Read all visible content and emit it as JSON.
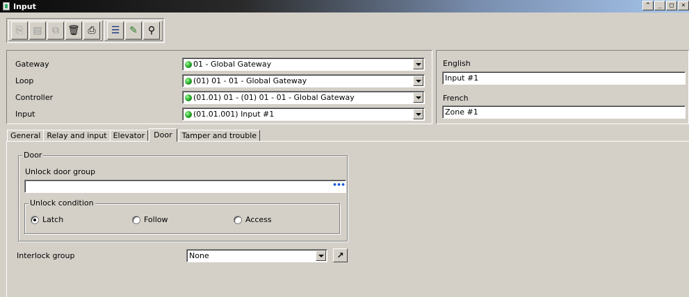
{
  "window": {
    "title": "Input",
    "controls": [
      "^",
      "_",
      "□",
      "×"
    ]
  },
  "toolbar": {
    "buttons": [
      {
        "icon": "new-doc-icon",
        "glyph": "⎘",
        "enabled": false
      },
      {
        "icon": "save-icon",
        "glyph": "▤",
        "enabled": false
      },
      {
        "icon": "copy-icon",
        "glyph": "⧉",
        "enabled": false
      },
      {
        "icon": "trash-icon",
        "glyph": "🗑",
        "enabled": true
      },
      {
        "icon": "print-icon",
        "glyph": "⎙",
        "enabled": true
      },
      {
        "icon": "list-icon",
        "glyph": "☰",
        "enabled": true
      },
      {
        "icon": "link-icon",
        "glyph": "✎",
        "enabled": true
      },
      {
        "icon": "binoculars-icon",
        "glyph": "⚲",
        "enabled": true
      }
    ]
  },
  "header": {
    "gateway": {
      "label": "Gateway",
      "value": "01 - Global Gateway"
    },
    "loop": {
      "label": "Loop",
      "value": "(01) 01 - 01 - Global Gateway"
    },
    "controller": {
      "label": "Controller",
      "value": "(01.01) 01 - (01) 01 - 01 - Global Gateway"
    },
    "input": {
      "label": "Input",
      "value": "(01.01.001) Input #1"
    }
  },
  "languages": {
    "english": {
      "label": "English",
      "value": "Input #1"
    },
    "french": {
      "label": "French",
      "value": "Zone #1"
    }
  },
  "tabs": [
    {
      "label": "General",
      "active": false
    },
    {
      "label": "Relay and input",
      "active": false
    },
    {
      "label": "Elevator",
      "active": false
    },
    {
      "label": "Door",
      "active": true
    },
    {
      "label": "Tamper and trouble",
      "active": false
    }
  ],
  "door": {
    "group_title": "Door",
    "unlock_door_group_label": "Unlock door group",
    "unlock_door_group_value": "",
    "ellipsis": "•••",
    "unlock_condition": {
      "title": "Unlock condition",
      "options": [
        "Latch",
        "Follow",
        "Access"
      ],
      "selected": "Latch"
    },
    "interlock_group": {
      "label": "Interlock group",
      "value": "None"
    }
  },
  "colors": {
    "accent_green": "#1a9a1a",
    "ellipsis_blue": "#1a5ad8",
    "window_bg": "#d4d0c8"
  }
}
